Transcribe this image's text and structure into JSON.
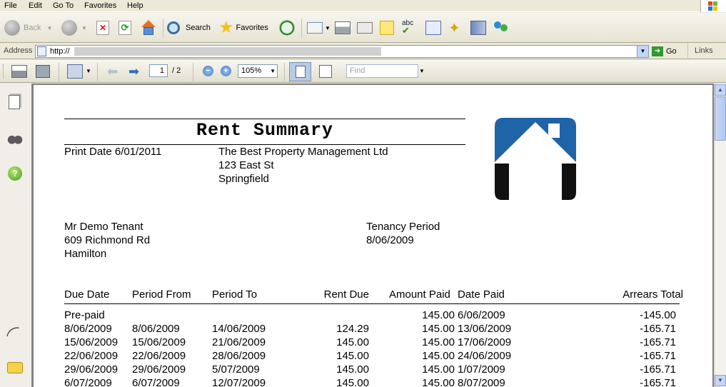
{
  "menu": [
    "File",
    "Edit",
    "Go To",
    "Favorites",
    "Help"
  ],
  "toolbar": {
    "back_label": "Back",
    "search_label": "Search",
    "favorites_label": "Favorites"
  },
  "address": {
    "label": "Address",
    "value": "http://",
    "go_label": "Go",
    "links_label": "Links"
  },
  "pdf_toolbar": {
    "page_current": "1",
    "page_total": "/ 2",
    "zoom": "105%",
    "find_placeholder": "Find"
  },
  "document": {
    "title": "Rent Summary",
    "print_date": "Print Date 6/01/2011",
    "company": [
      "The Best Property Management Ltd",
      "123 East St",
      "Springfield"
    ],
    "tenant": [
      "Mr Demo Tenant",
      "609 Richmond Rd",
      "Hamilton"
    ],
    "tenancy_label": "Tenancy Period",
    "tenancy_start": "8/06/2009",
    "headers": {
      "due_date": "Due Date",
      "period_from": "Period From",
      "period_to": "Period To",
      "rent_due": "Rent Due",
      "amount_paid": "Amount Paid",
      "date_paid": "Date Paid",
      "arrears": "Arrears Total"
    },
    "rows": [
      {
        "due": "Pre-paid",
        "from": "",
        "to": "",
        "rent": "",
        "paid": "145.00",
        "date": "6/06/2009",
        "arrears": "-145.00"
      },
      {
        "due": "8/06/2009",
        "from": "8/06/2009",
        "to": "14/06/2009",
        "rent": "124.29",
        "paid": "145.00",
        "date": "13/06/2009",
        "arrears": "-165.71"
      },
      {
        "due": "15/06/2009",
        "from": "15/06/2009",
        "to": "21/06/2009",
        "rent": "145.00",
        "paid": "145.00",
        "date": "17/06/2009",
        "arrears": "-165.71"
      },
      {
        "due": "22/06/2009",
        "from": "22/06/2009",
        "to": "28/06/2009",
        "rent": "145.00",
        "paid": "145.00",
        "date": "24/06/2009",
        "arrears": "-165.71"
      },
      {
        "due": "29/06/2009",
        "from": "29/06/2009",
        "to": "5/07/2009",
        "rent": "145.00",
        "paid": "145.00",
        "date": "1/07/2009",
        "arrears": "-165.71"
      },
      {
        "due": "6/07/2009",
        "from": "6/07/2009",
        "to": "12/07/2009",
        "rent": "145.00",
        "paid": "145.00",
        "date": "8/07/2009",
        "arrears": "-165.71"
      }
    ]
  },
  "colors": {
    "logo_blue": "#1f63a8",
    "logo_black": "#111111",
    "paper": "#ffffff",
    "viewer_bg": "#808080"
  }
}
